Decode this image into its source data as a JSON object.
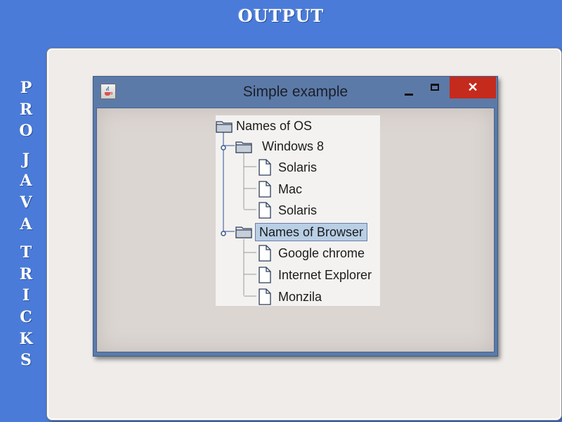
{
  "banner": {
    "title": "OUTPUT"
  },
  "side_text": [
    "P",
    "R",
    "O",
    "",
    "J",
    "A",
    "V",
    "A",
    "",
    "T",
    "R",
    "I",
    "C",
    "K",
    "S"
  ],
  "window": {
    "title": "Simple example",
    "close_label": "✕",
    "app_icon": "java-cup-icon"
  },
  "tree": {
    "root": {
      "label": "Names  of  OS",
      "icon": "folder-icon"
    },
    "nodes": [
      {
        "label": "Windows  8",
        "icon": "folder-icon",
        "expanded": true
      },
      {
        "label": "Solaris",
        "icon": "file-icon"
      },
      {
        "label": "Mac",
        "icon": "file-icon"
      },
      {
        "label": "Solaris",
        "icon": "file-icon"
      },
      {
        "label": "Names  of  Browser",
        "icon": "folder-icon",
        "expanded": true,
        "selected": true
      },
      {
        "label": "Google chrome",
        "icon": "file-icon"
      },
      {
        "label": "Internet Explorer",
        "icon": "file-icon"
      },
      {
        "label": "Monzila",
        "icon": "file-icon"
      }
    ]
  },
  "colors": {
    "background": "#4a7bd8",
    "frame": "#efecea",
    "window_border": "#5c7aa8",
    "close_button": "#c42b1c",
    "selection": "#b8cfe5"
  }
}
